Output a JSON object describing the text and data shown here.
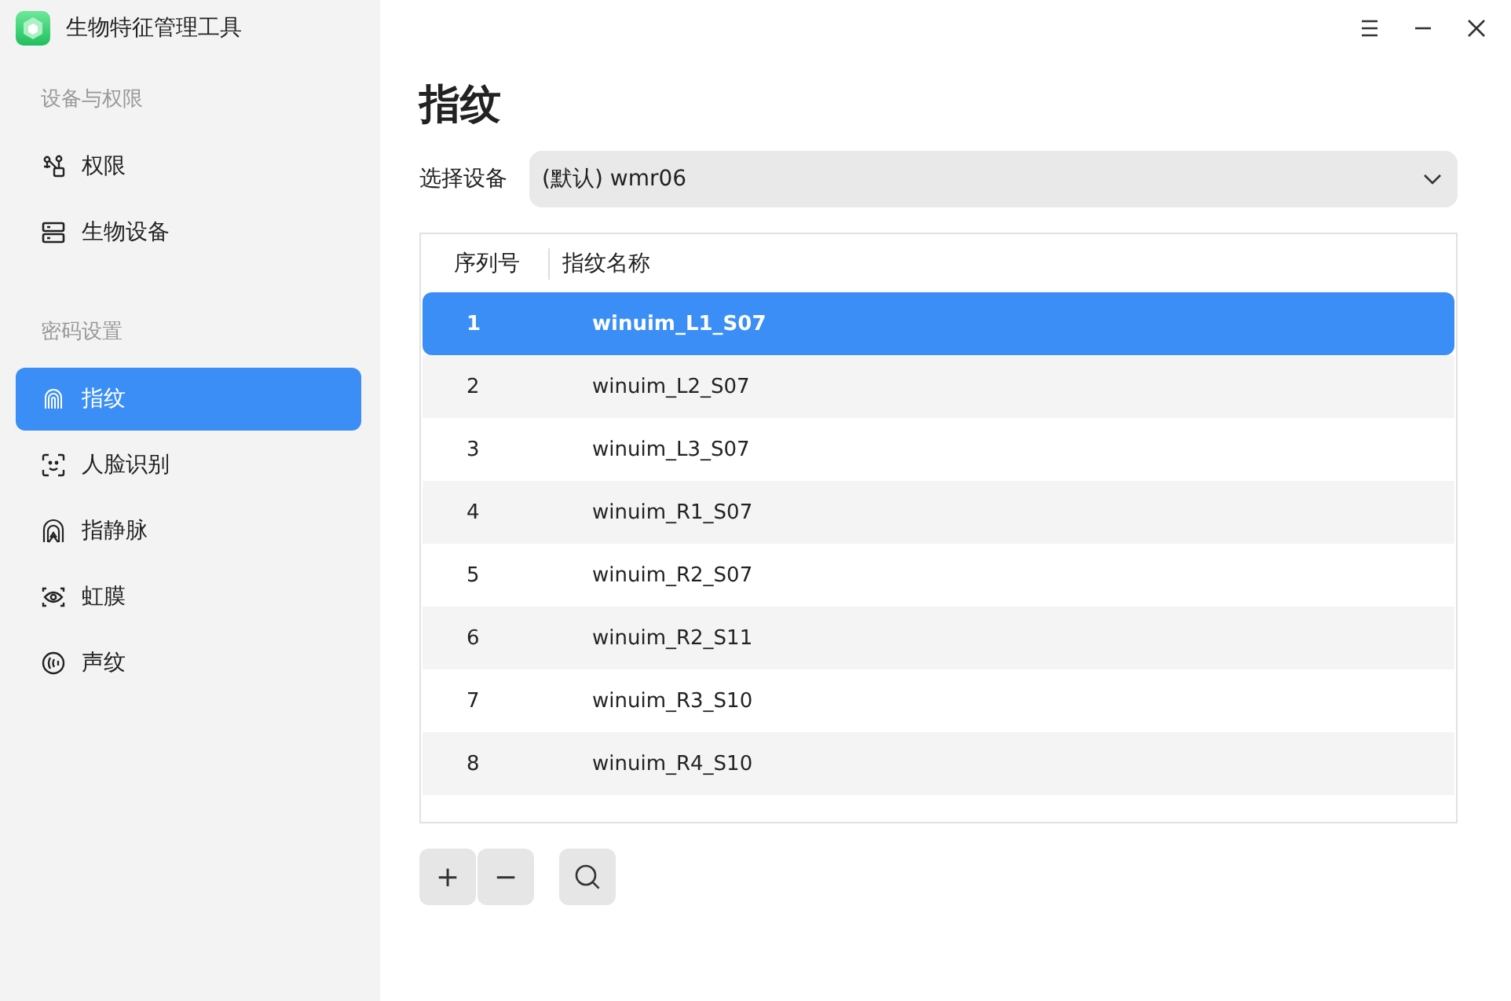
{
  "window": {
    "title": "生物特征管理工具"
  },
  "sidebar": {
    "sections": [
      {
        "heading": "设备与权限",
        "items": [
          {
            "label": "权限",
            "selected": false
          },
          {
            "label": "生物设备",
            "selected": false
          }
        ]
      },
      {
        "heading": "密码设置",
        "items": [
          {
            "label": "指纹",
            "selected": true
          },
          {
            "label": "人脸识别",
            "selected": false
          },
          {
            "label": "指静脉",
            "selected": false
          },
          {
            "label": "虹膜",
            "selected": false
          },
          {
            "label": "声纹",
            "selected": false
          }
        ]
      }
    ]
  },
  "page": {
    "title": "指纹"
  },
  "device_select": {
    "label": "选择设备",
    "value": "(默认) wmr06"
  },
  "table": {
    "columns": [
      "序列号",
      "指纹名称"
    ],
    "rows": [
      {
        "cells": [
          "1",
          "winuim_L1_S07"
        ],
        "selected": true
      },
      {
        "cells": [
          "2",
          "winuim_L2_S07"
        ],
        "selected": false
      },
      {
        "cells": [
          "3",
          "winuim_L3_S07"
        ],
        "selected": false
      },
      {
        "cells": [
          "4",
          "winuim_R1_S07"
        ],
        "selected": false
      },
      {
        "cells": [
          "5",
          "winuim_R2_S07"
        ],
        "selected": false
      },
      {
        "cells": [
          "6",
          "winuim_R2_S11"
        ],
        "selected": false
      },
      {
        "cells": [
          "7",
          "winuim_R3_S10"
        ],
        "selected": false
      },
      {
        "cells": [
          "8",
          "winuim_R4_S10"
        ],
        "selected": false
      }
    ]
  },
  "actions": [
    {
      "label": "+"
    },
    {
      "label": "−"
    }
  ]
}
